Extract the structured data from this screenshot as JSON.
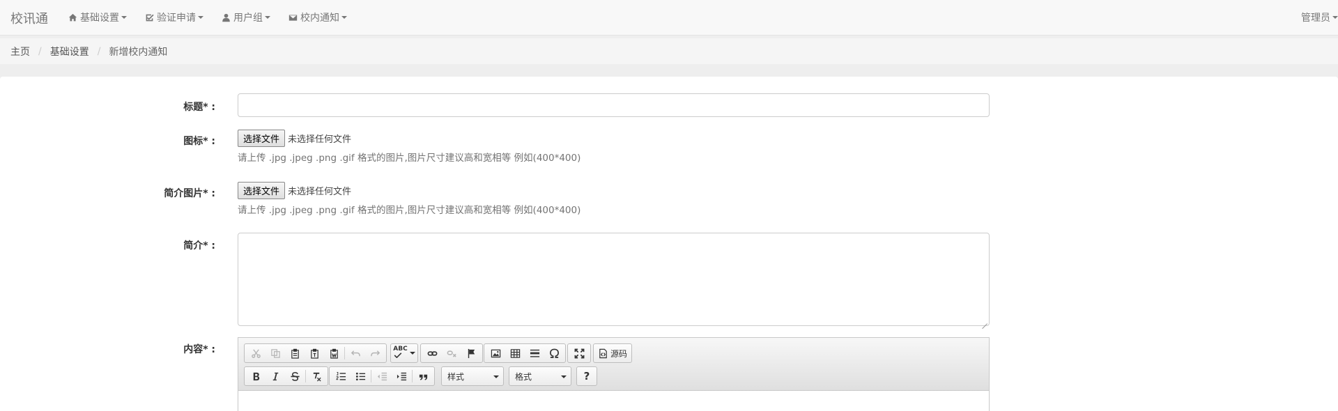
{
  "navbar": {
    "brand": "校讯通",
    "items": [
      {
        "label": "基础设置",
        "icon": "home-icon"
      },
      {
        "label": "验证申请",
        "icon": "check-square-icon"
      },
      {
        "label": "用户组",
        "icon": "user-icon"
      },
      {
        "label": "校内通知",
        "icon": "envelope-icon"
      }
    ],
    "user": "管理员"
  },
  "breadcrumb": {
    "items": [
      "主页",
      "基础设置"
    ],
    "active": "新增校内通知"
  },
  "form": {
    "title_label": "标题* :",
    "title_value": "",
    "icon_label": "图标* :",
    "icon_button": "选择文件",
    "icon_status": "未选择任何文件",
    "icon_help": "请上传 .jpg .jpeg .png .gif 格式的图片,图片尺寸建议高和宽相等 例如(400*400)",
    "cover_label": "简介图片* :",
    "cover_button": "选择文件",
    "cover_status": "未选择任何文件",
    "cover_help": "请上传 .jpg .jpeg .png .gif 格式的图片,图片尺寸建议高和宽相等 例如(400*400)",
    "summary_label": "简介* :",
    "summary_value": "",
    "content_label": "内容* :"
  },
  "editor": {
    "source_label": "源码",
    "style_combo": "样式",
    "format_combo": "格式",
    "help_label": "?",
    "abc_label": "ABC"
  },
  "colors": {
    "navbar_bg": "#f8f8f8",
    "page_bg": "#eeeeee",
    "panel_bg": "#ffffff"
  }
}
